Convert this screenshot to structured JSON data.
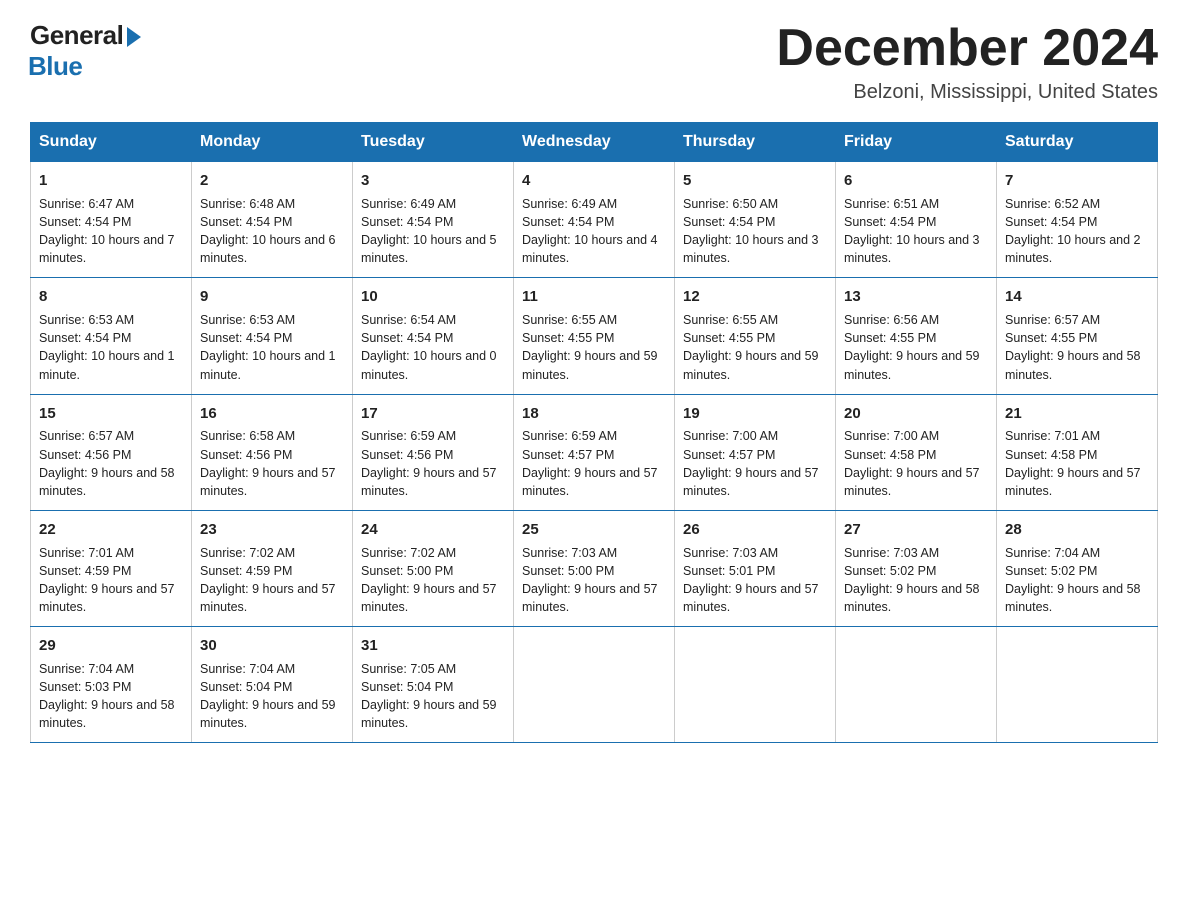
{
  "header": {
    "logo_general": "General",
    "logo_blue": "Blue",
    "month_title": "December 2024",
    "location": "Belzoni, Mississippi, United States"
  },
  "weekdays": [
    "Sunday",
    "Monday",
    "Tuesday",
    "Wednesday",
    "Thursday",
    "Friday",
    "Saturday"
  ],
  "weeks": [
    [
      {
        "day": "1",
        "sunrise": "6:47 AM",
        "sunset": "4:54 PM",
        "daylight": "10 hours and 7 minutes."
      },
      {
        "day": "2",
        "sunrise": "6:48 AM",
        "sunset": "4:54 PM",
        "daylight": "10 hours and 6 minutes."
      },
      {
        "day": "3",
        "sunrise": "6:49 AM",
        "sunset": "4:54 PM",
        "daylight": "10 hours and 5 minutes."
      },
      {
        "day": "4",
        "sunrise": "6:49 AM",
        "sunset": "4:54 PM",
        "daylight": "10 hours and 4 minutes."
      },
      {
        "day": "5",
        "sunrise": "6:50 AM",
        "sunset": "4:54 PM",
        "daylight": "10 hours and 3 minutes."
      },
      {
        "day": "6",
        "sunrise": "6:51 AM",
        "sunset": "4:54 PM",
        "daylight": "10 hours and 3 minutes."
      },
      {
        "day": "7",
        "sunrise": "6:52 AM",
        "sunset": "4:54 PM",
        "daylight": "10 hours and 2 minutes."
      }
    ],
    [
      {
        "day": "8",
        "sunrise": "6:53 AM",
        "sunset": "4:54 PM",
        "daylight": "10 hours and 1 minute."
      },
      {
        "day": "9",
        "sunrise": "6:53 AM",
        "sunset": "4:54 PM",
        "daylight": "10 hours and 1 minute."
      },
      {
        "day": "10",
        "sunrise": "6:54 AM",
        "sunset": "4:54 PM",
        "daylight": "10 hours and 0 minutes."
      },
      {
        "day": "11",
        "sunrise": "6:55 AM",
        "sunset": "4:55 PM",
        "daylight": "9 hours and 59 minutes."
      },
      {
        "day": "12",
        "sunrise": "6:55 AM",
        "sunset": "4:55 PM",
        "daylight": "9 hours and 59 minutes."
      },
      {
        "day": "13",
        "sunrise": "6:56 AM",
        "sunset": "4:55 PM",
        "daylight": "9 hours and 59 minutes."
      },
      {
        "day": "14",
        "sunrise": "6:57 AM",
        "sunset": "4:55 PM",
        "daylight": "9 hours and 58 minutes."
      }
    ],
    [
      {
        "day": "15",
        "sunrise": "6:57 AM",
        "sunset": "4:56 PM",
        "daylight": "9 hours and 58 minutes."
      },
      {
        "day": "16",
        "sunrise": "6:58 AM",
        "sunset": "4:56 PM",
        "daylight": "9 hours and 57 minutes."
      },
      {
        "day": "17",
        "sunrise": "6:59 AM",
        "sunset": "4:56 PM",
        "daylight": "9 hours and 57 minutes."
      },
      {
        "day": "18",
        "sunrise": "6:59 AM",
        "sunset": "4:57 PM",
        "daylight": "9 hours and 57 minutes."
      },
      {
        "day": "19",
        "sunrise": "7:00 AM",
        "sunset": "4:57 PM",
        "daylight": "9 hours and 57 minutes."
      },
      {
        "day": "20",
        "sunrise": "7:00 AM",
        "sunset": "4:58 PM",
        "daylight": "9 hours and 57 minutes."
      },
      {
        "day": "21",
        "sunrise": "7:01 AM",
        "sunset": "4:58 PM",
        "daylight": "9 hours and 57 minutes."
      }
    ],
    [
      {
        "day": "22",
        "sunrise": "7:01 AM",
        "sunset": "4:59 PM",
        "daylight": "9 hours and 57 minutes."
      },
      {
        "day": "23",
        "sunrise": "7:02 AM",
        "sunset": "4:59 PM",
        "daylight": "9 hours and 57 minutes."
      },
      {
        "day": "24",
        "sunrise": "7:02 AM",
        "sunset": "5:00 PM",
        "daylight": "9 hours and 57 minutes."
      },
      {
        "day": "25",
        "sunrise": "7:03 AM",
        "sunset": "5:00 PM",
        "daylight": "9 hours and 57 minutes."
      },
      {
        "day": "26",
        "sunrise": "7:03 AM",
        "sunset": "5:01 PM",
        "daylight": "9 hours and 57 minutes."
      },
      {
        "day": "27",
        "sunrise": "7:03 AM",
        "sunset": "5:02 PM",
        "daylight": "9 hours and 58 minutes."
      },
      {
        "day": "28",
        "sunrise": "7:04 AM",
        "sunset": "5:02 PM",
        "daylight": "9 hours and 58 minutes."
      }
    ],
    [
      {
        "day": "29",
        "sunrise": "7:04 AM",
        "sunset": "5:03 PM",
        "daylight": "9 hours and 58 minutes."
      },
      {
        "day": "30",
        "sunrise": "7:04 AM",
        "sunset": "5:04 PM",
        "daylight": "9 hours and 59 minutes."
      },
      {
        "day": "31",
        "sunrise": "7:05 AM",
        "sunset": "5:04 PM",
        "daylight": "9 hours and 59 minutes."
      },
      null,
      null,
      null,
      null
    ]
  ],
  "labels": {
    "sunrise": "Sunrise: ",
    "sunset": "Sunset: ",
    "daylight": "Daylight: "
  }
}
